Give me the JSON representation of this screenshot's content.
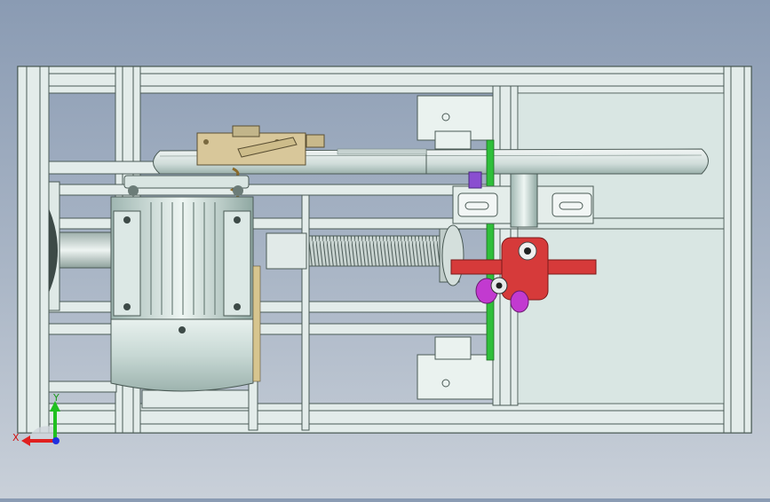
{
  "view": {
    "background_top": "#8a9bb3",
    "background_bottom": "#c9d0d9",
    "frame_color": "#e3ecea",
    "frame_edge": "#4a5a55",
    "panel_color": "#d6e3e0"
  },
  "model": {
    "components": [
      "frame",
      "electric-motor",
      "motor-shaft",
      "lead-screw",
      "drive-belt",
      "pulley",
      "clamp-bracket",
      "red-cam-disk",
      "magenta-roller",
      "green-guide-rod",
      "slider-block",
      "bearing-mounts"
    ],
    "colors": {
      "motor_body": "#cfe0dc",
      "cam": "#d63a3a",
      "roller": "#c23ad0",
      "guide_rod": "#2fbf3a",
      "bracket": "#d8c79a"
    }
  },
  "triad": {
    "x_label": "X",
    "y_label": "Y",
    "x_color": "#e02020",
    "y_color": "#20c020",
    "z_color": "#2030e0"
  }
}
